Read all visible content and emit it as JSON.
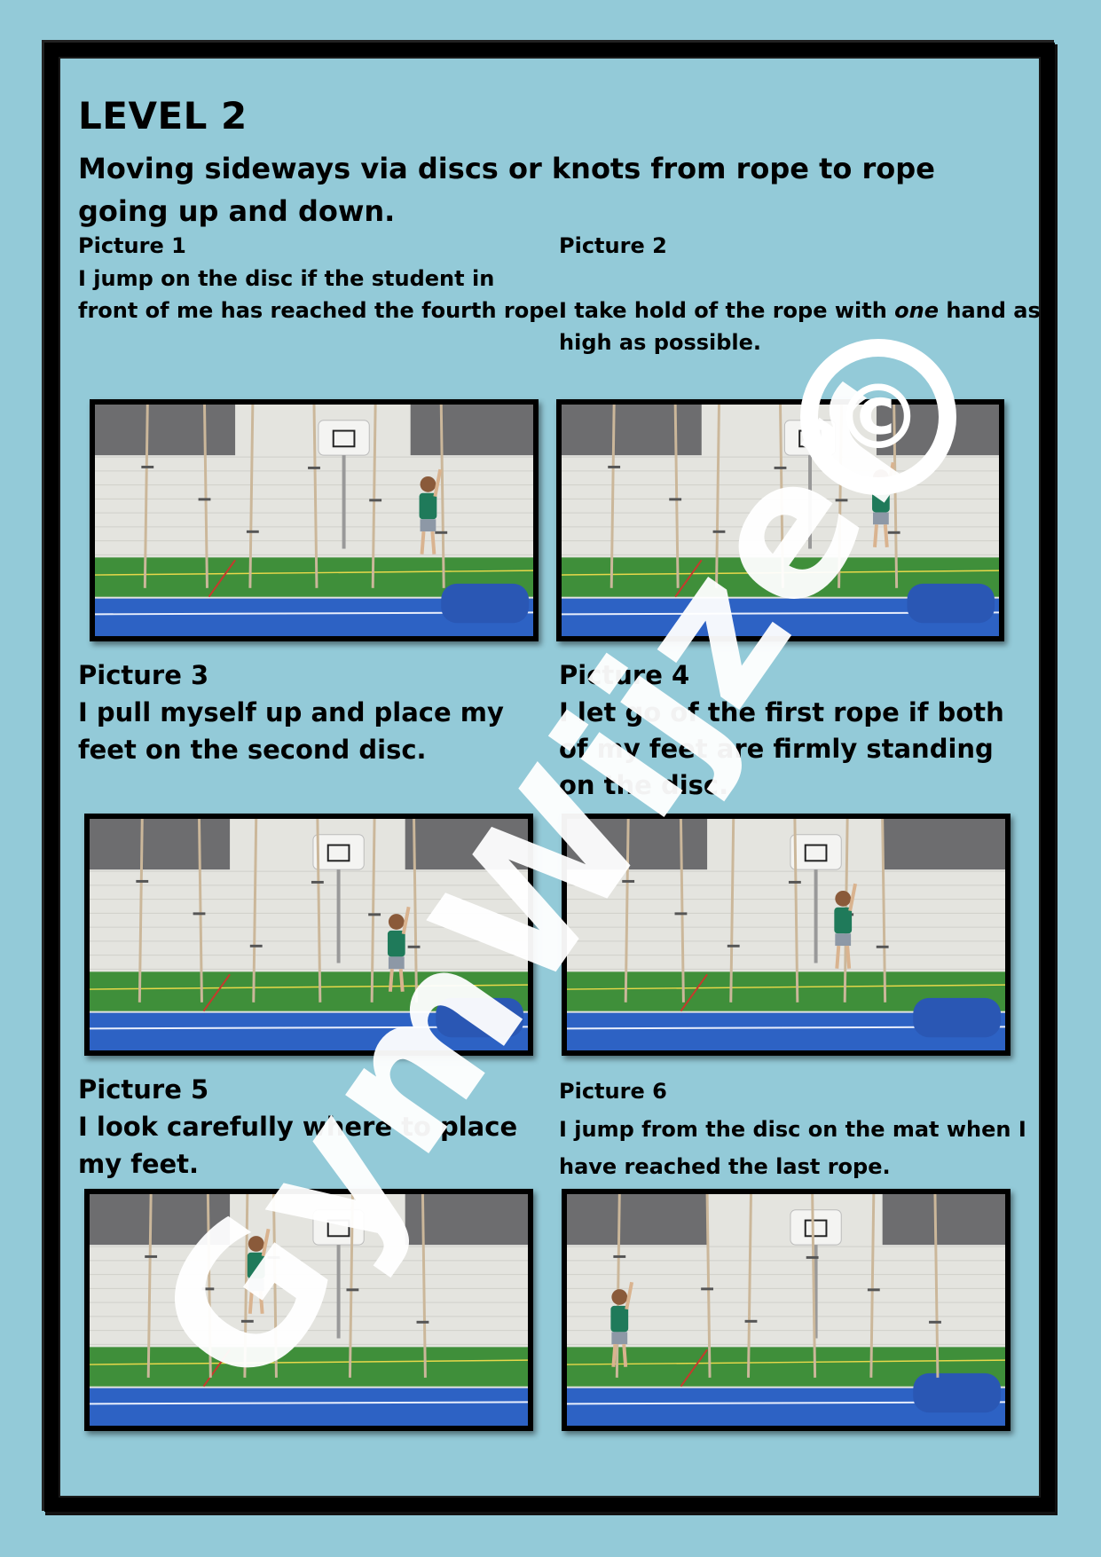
{
  "page": {
    "level": "LEVEL 2",
    "subtitle": "Moving sideways via discs or knots from rope to rope going up and down."
  },
  "pictures": [
    {
      "label": "Picture 1",
      "lines": [
        "I jump on the disc if the student in",
        "front of me has reached the fourth rope."
      ]
    },
    {
      "label": "Picture 2",
      "lines_before": "I take hold of the rope with ",
      "emphasis": "one",
      "lines_after": " hand as",
      "line2": "high as possible."
    },
    {
      "label": "Picture 3",
      "lines": [
        "I pull myself up and place my",
        "feet on the second disc."
      ]
    },
    {
      "label": "Picture 4",
      "lines": [
        "I let go of the first rope if both",
        "of my feet are firmly standing",
        "on the disc."
      ]
    },
    {
      "label": "Picture 5",
      "lines": [
        "I look carefully where to place",
        "my feet."
      ]
    },
    {
      "label": "Picture 6",
      "lines": [
        "I jump from the disc on the mat when I",
        "have reached the last rope."
      ]
    }
  ],
  "watermark": {
    "text": "GymWijzer",
    "symbol": "©"
  },
  "colors": {
    "background": "#93cad8",
    "floor": "#3f8f3a",
    "mat": "#2d62c4",
    "wall": "#e6e6e1"
  }
}
